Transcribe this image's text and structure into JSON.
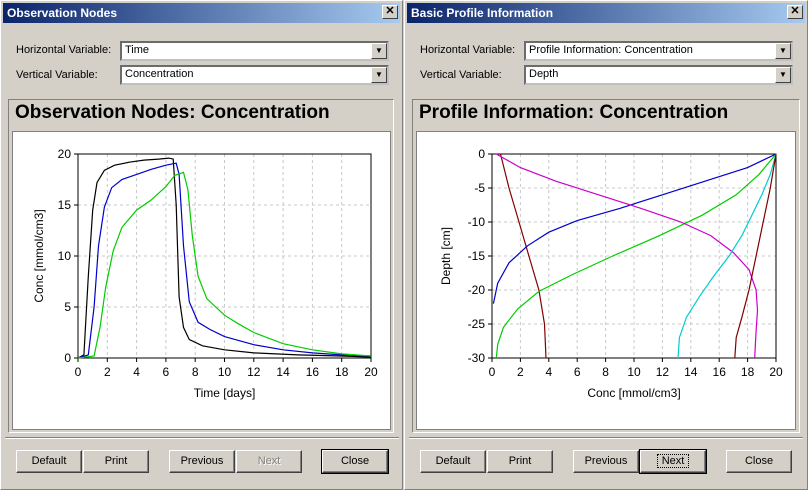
{
  "left_window": {
    "title": "Observation Nodes",
    "close_glyph": "✕",
    "horizontal_label": "Horizontal Variable:",
    "horizontal_value": "Time",
    "vertical_label": "Vertical Variable:",
    "vertical_value": "Concentration",
    "chart_heading": "Observation Nodes: Concentration",
    "buttons": {
      "default": "Default",
      "print": "Print",
      "previous": "Previous",
      "next": "Next",
      "close": "Close"
    }
  },
  "right_window": {
    "title": "Basic Profile Information",
    "close_glyph": "✕",
    "horizontal_label": "Horizontal Variable:",
    "horizontal_value": "Profile Information:  Concentration",
    "vertical_label": "Vertical Variable:",
    "vertical_value": "Depth",
    "chart_heading": "Profile Information:  Concentration",
    "buttons": {
      "default": "Default",
      "print": "Print",
      "previous": "Previous",
      "next": "Next",
      "close": "Close"
    }
  },
  "chart_data": [
    {
      "type": "line",
      "title": "Observation Nodes: Concentration",
      "xlabel": "Time [days]",
      "ylabel": "Conc [mmol/cm3]",
      "xlim": [
        0,
        20
      ],
      "ylim": [
        0,
        20
      ],
      "xticks": [
        0,
        2,
        4,
        6,
        8,
        10,
        12,
        14,
        16,
        18,
        20
      ],
      "yticks": [
        0,
        5,
        10,
        15,
        20
      ],
      "grid": true,
      "series": [
        {
          "color": "#000000",
          "points": [
            [
              0,
              0
            ],
            [
              0.4,
              0.3
            ],
            [
              0.7,
              8
            ],
            [
              1,
              14.5
            ],
            [
              1.3,
              17.2
            ],
            [
              1.8,
              18.4
            ],
            [
              2.5,
              18.9
            ],
            [
              3.5,
              19.2
            ],
            [
              4.5,
              19.4
            ],
            [
              5.5,
              19.5
            ],
            [
              6.2,
              19.6
            ],
            [
              6.5,
              19.5
            ],
            [
              6.7,
              15
            ],
            [
              6.9,
              6
            ],
            [
              7.2,
              3
            ],
            [
              7.6,
              1.8
            ],
            [
              8.5,
              1.2
            ],
            [
              10,
              0.8
            ],
            [
              12,
              0.5
            ],
            [
              15,
              0.3
            ],
            [
              18,
              0.2
            ],
            [
              20,
              0.1
            ]
          ]
        },
        {
          "color": "#0000cc",
          "points": [
            [
              0,
              0
            ],
            [
              0.7,
              0.3
            ],
            [
              1.1,
              5
            ],
            [
              1.4,
              11
            ],
            [
              1.8,
              14.8
            ],
            [
              2.3,
              16.7
            ],
            [
              3,
              17.5
            ],
            [
              4,
              18
            ],
            [
              5,
              18.5
            ],
            [
              6,
              18.9
            ],
            [
              6.7,
              19.1
            ],
            [
              6.9,
              18
            ],
            [
              7.2,
              11
            ],
            [
              7.6,
              5.5
            ],
            [
              8.2,
              3.5
            ],
            [
              9,
              2.8
            ],
            [
              10,
              2.1
            ],
            [
              12,
              1.3
            ],
            [
              14,
              0.8
            ],
            [
              16,
              0.5
            ],
            [
              18,
              0.3
            ],
            [
              20,
              0.2
            ]
          ]
        },
        {
          "color": "#00cc00",
          "points": [
            [
              0,
              0
            ],
            [
              1.1,
              0.2
            ],
            [
              1.5,
              3
            ],
            [
              1.9,
              7
            ],
            [
              2.4,
              10.5
            ],
            [
              3,
              12.8
            ],
            [
              4,
              14.5
            ],
            [
              5,
              15.5
            ],
            [
              6,
              16.8
            ],
            [
              6.6,
              17.9
            ],
            [
              7.2,
              18.2
            ],
            [
              7.5,
              16.5
            ],
            [
              7.8,
              12
            ],
            [
              8.2,
              8
            ],
            [
              8.8,
              5.8
            ],
            [
              10,
              4.2
            ],
            [
              11,
              3.3
            ],
            [
              12,
              2.5
            ],
            [
              14,
              1.4
            ],
            [
              16,
              0.8
            ],
            [
              18,
              0.4
            ],
            [
              20,
              0.2
            ]
          ]
        }
      ]
    },
    {
      "type": "line",
      "title": "Profile Information:  Concentration",
      "xlabel": "Conc [mmol/cm3]",
      "ylabel": "Depth [cm]",
      "xlim": [
        0,
        20
      ],
      "ylim": [
        -30,
        0
      ],
      "xticks": [
        0,
        2,
        4,
        6,
        8,
        10,
        12,
        14,
        16,
        18,
        20
      ],
      "yticks": [
        0,
        -5,
        -10,
        -15,
        -20,
        -25,
        -30
      ],
      "grid": true,
      "series": [
        {
          "color": "#800000",
          "points": [
            [
              0.6,
              0
            ],
            [
              1.2,
              -5
            ],
            [
              1.9,
              -10
            ],
            [
              2.6,
              -15
            ],
            [
              3.3,
              -20
            ],
            [
              3.7,
              -25
            ],
            [
              3.8,
              -30
            ]
          ]
        },
        {
          "color": "#0000cc",
          "points": [
            [
              20,
              0
            ],
            [
              18,
              -2
            ],
            [
              15,
              -4
            ],
            [
              12,
              -6
            ],
            [
              9,
              -8
            ],
            [
              6,
              -9.8
            ],
            [
              4,
              -11.5
            ],
            [
              2.5,
              -13.5
            ],
            [
              1.2,
              -16
            ],
            [
              0.4,
              -19
            ],
            [
              0.1,
              -22
            ]
          ]
        },
        {
          "color": "#00cc00",
          "points": [
            [
              20,
              0
            ],
            [
              18.8,
              -3
            ],
            [
              17.2,
              -6
            ],
            [
              14.8,
              -9
            ],
            [
              11.8,
              -12
            ],
            [
              8.5,
              -15
            ],
            [
              5.6,
              -17.8
            ],
            [
              3.3,
              -20.2
            ],
            [
              1.8,
              -22.8
            ],
            [
              0.8,
              -25.5
            ],
            [
              0.4,
              -28
            ],
            [
              0.3,
              -30
            ]
          ]
        },
        {
          "color": "#cc00cc",
          "points": [
            [
              0.3,
              0
            ],
            [
              2,
              -2
            ],
            [
              4.5,
              -4
            ],
            [
              7.5,
              -6
            ],
            [
              10.5,
              -8
            ],
            [
              13.3,
              -10
            ],
            [
              15.4,
              -12
            ],
            [
              17,
              -14.5
            ],
            [
              18.1,
              -17
            ],
            [
              18.6,
              -20
            ],
            [
              18.7,
              -23
            ],
            [
              18.6,
              -26
            ],
            [
              18.5,
              -30
            ]
          ]
        },
        {
          "color": "#00cccc",
          "points": [
            [
              20,
              0
            ],
            [
              19.6,
              -3
            ],
            [
              19,
              -6
            ],
            [
              18.3,
              -9
            ],
            [
              17.6,
              -12
            ],
            [
              16.7,
              -15
            ],
            [
              15.6,
              -18
            ],
            [
              14.6,
              -21
            ],
            [
              13.7,
              -24
            ],
            [
              13.2,
              -27
            ],
            [
              13.1,
              -30
            ]
          ]
        },
        {
          "color": "#800000",
          "points": [
            [
              20,
              0
            ],
            [
              19.6,
              -5
            ],
            [
              19.1,
              -10
            ],
            [
              18.6,
              -15
            ],
            [
              18.1,
              -20
            ],
            [
              17.6,
              -24
            ],
            [
              17.2,
              -27
            ],
            [
              17.1,
              -30
            ]
          ]
        }
      ]
    }
  ]
}
